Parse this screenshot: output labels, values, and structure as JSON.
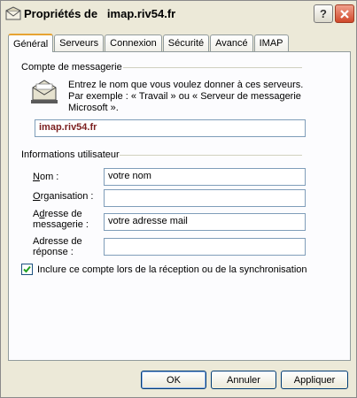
{
  "window": {
    "title": "Propriétés de   imap.riv54.fr",
    "help_label": "?",
    "close_label": "✕"
  },
  "tabs": [
    {
      "label": "Général",
      "active": true
    },
    {
      "label": "Serveurs",
      "active": false
    },
    {
      "label": "Connexion",
      "active": false
    },
    {
      "label": "Sécurité",
      "active": false
    },
    {
      "label": "Avancé",
      "active": false
    },
    {
      "label": "IMAP",
      "active": false
    }
  ],
  "account_group": {
    "label": "Compte de messagerie",
    "description_lines": [
      "Entrez le nom que vous voulez donner à ces serveurs.",
      "Par exemple : « Travail » ou « Serveur de messagerie",
      "Microsoft »."
    ],
    "account_name": "imap.riv54.fr"
  },
  "user_group": {
    "label": "Informations utilisateur",
    "fields": [
      {
        "label_lines": [
          "Nom :"
        ],
        "value": "votre nom"
      },
      {
        "label_lines": [
          "Organisation :"
        ],
        "value": ""
      },
      {
        "label_lines": [
          "Adresse de",
          "messagerie :"
        ],
        "value": "votre adresse mail"
      },
      {
        "label_lines": [
          "Adresse de",
          "réponse :"
        ],
        "value": ""
      }
    ]
  },
  "include_checkbox": {
    "label": "Inclure ce compte lors de la réception ou de la synchronisation",
    "checked": true
  },
  "buttons": {
    "ok": "OK",
    "cancel": "Annuler",
    "apply": "Appliquer"
  }
}
